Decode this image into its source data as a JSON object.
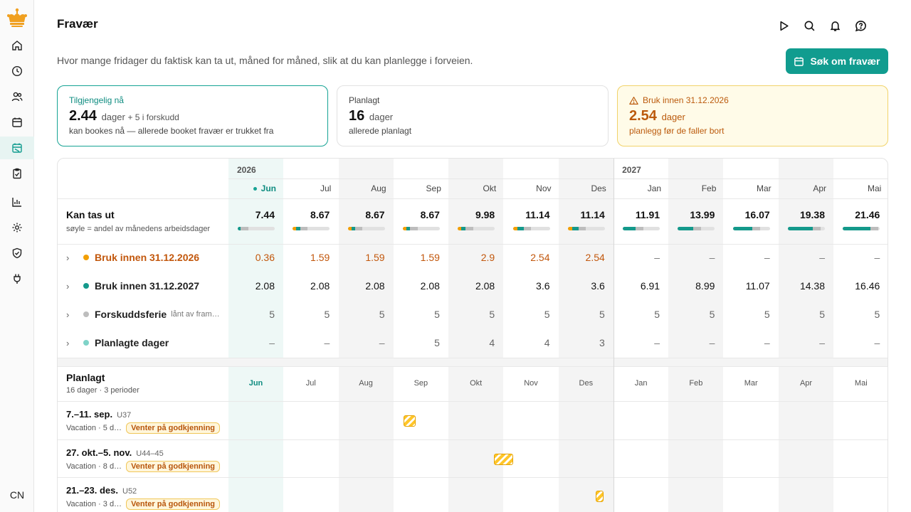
{
  "page": {
    "title": "Fravær",
    "subtitle": "Hvor mange fridager du faktisk kan ta ut, måned for måned, slik at du kan planlegge i forveien.",
    "apply_button": "Søk om fravær",
    "avatar": "CN"
  },
  "sidebar": {
    "items": [
      {
        "icon": "home-icon"
      },
      {
        "icon": "clock-icon"
      },
      {
        "icon": "people-icon"
      },
      {
        "icon": "calendar-icon"
      },
      {
        "icon": "absence-calendar-icon",
        "active": true
      },
      {
        "icon": "clipboard-icon"
      },
      {
        "icon": "bar-chart-icon"
      },
      {
        "icon": "gear-icon"
      },
      {
        "icon": "shield-check-icon"
      },
      {
        "icon": "plug-icon"
      }
    ]
  },
  "cards": {
    "available": {
      "label": "Tilgjengelig nå",
      "value": "2.44",
      "unit": "dager",
      "extra": "+ 5 i forskudd",
      "sub": "kan bookes nå — allerede booket fravær er trukket fra"
    },
    "planned": {
      "label": "Planlagt",
      "value": "16",
      "unit": "dager",
      "sub": "allerede planlagt"
    },
    "use_by": {
      "label": "Bruk innen 31.12.2026",
      "value": "2.54",
      "unit": "dager",
      "sub": "planlegg før de faller bort"
    }
  },
  "years": [
    "2026",
    "2027"
  ],
  "months": [
    "Jun",
    "Jul",
    "Aug",
    "Sep",
    "Okt",
    "Nov",
    "Des",
    "Jan",
    "Feb",
    "Mar",
    "Apr",
    "Mai"
  ],
  "kan": {
    "title": "Kan tas ut",
    "sub": "søyle = andel av månedens arbeidsdager",
    "values": [
      "7.44",
      "8.67",
      "8.67",
      "8.67",
      "9.98",
      "11.14",
      "11.14",
      "11.91",
      "13.99",
      "16.07",
      "19.38",
      "21.46"
    ],
    "bar_parts": [
      [
        0,
        0.08,
        0.2
      ],
      [
        0.1,
        0.1,
        0.2
      ],
      [
        0.1,
        0.1,
        0.2
      ],
      [
        0.1,
        0.1,
        0.2
      ],
      [
        0.1,
        0.1,
        0.22
      ],
      [
        0.12,
        0.17,
        0.2
      ],
      [
        0.12,
        0.17,
        0.2
      ],
      [
        0,
        0.35,
        0.2
      ],
      [
        0,
        0.42,
        0.2
      ],
      [
        0,
        0.53,
        0.2
      ],
      [
        0,
        0.68,
        0.2
      ],
      [
        0,
        0.75,
        0.2
      ]
    ]
  },
  "rows": [
    {
      "label": "Bruk innen 31.12.2026",
      "color": "#f29f05",
      "style": "orange",
      "values": [
        "0.36",
        "1.59",
        "1.59",
        "1.59",
        "2.9",
        "2.54",
        "2.54",
        "–",
        "–",
        "–",
        "–",
        "–"
      ]
    },
    {
      "label": "Bruk innen 31.12.2027",
      "color": "#14998b",
      "style": "dark",
      "values": [
        "2.08",
        "2.08",
        "2.08",
        "2.08",
        "2.08",
        "3.6",
        "3.6",
        "6.91",
        "8.99",
        "11.07",
        "14.38",
        "16.46"
      ]
    },
    {
      "label": "Forskuddsferie",
      "note": "lånt av fram…",
      "color": "#bdbdbd",
      "style": "gray",
      "values": [
        "5",
        "5",
        "5",
        "5",
        "5",
        "5",
        "5",
        "5",
        "5",
        "5",
        "5",
        "5"
      ]
    },
    {
      "label": "Planlagte dager",
      "color": "#7fd3c8",
      "style": "gray",
      "values": [
        "–",
        "–",
        "–",
        "5",
        "4",
        "4",
        "3",
        "–",
        "–",
        "–",
        "–",
        "–"
      ]
    }
  ],
  "planned": {
    "title": "Planlagt",
    "sub": "16 dager · 3 perioder",
    "periods": [
      {
        "dates": "7.–11. sep.",
        "week": "U37",
        "info": "Vacation · 5 d…",
        "status": "Venter på godkjenning"
      },
      {
        "dates": "27. okt.–5. nov.",
        "week": "U44–45",
        "info": "Vacation · 8 d…",
        "status": "Venter på godkjenning"
      },
      {
        "dates": "21.–23. des.",
        "week": "U52",
        "info": "Vacation · 3 d…",
        "status": "Venter på godkjenning"
      }
    ]
  }
}
